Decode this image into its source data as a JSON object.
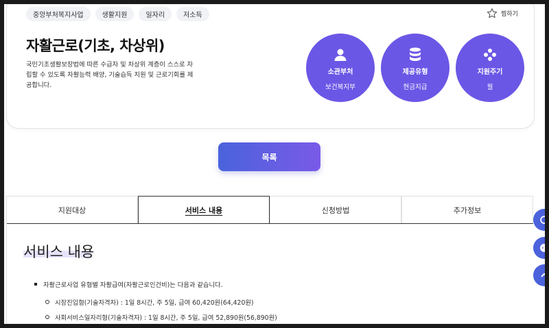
{
  "tags": [
    "중앙부처복지사업",
    "생활지원",
    "일자리",
    "저소득"
  ],
  "favorite_label": "찜하기",
  "title": "자활근로(기초, 차상위)",
  "description": "국민기초생활보장법에 따른 수급자 및 차상위 계층이 스스로 자립할 수 있도록 자활능력 배양, 기술습득 지원 및 근로기회를 제공합니다.",
  "info": [
    {
      "label": "소관부처",
      "value": "보건복지부",
      "icon": "person-icon"
    },
    {
      "label": "제공유형",
      "value": "현금지급",
      "icon": "database-icon"
    },
    {
      "label": "지원주기",
      "value": "월",
      "icon": "dots-diamond-icon"
    }
  ],
  "list_button": "목록",
  "tabs": [
    "지원대상",
    "서비스 내용",
    "신청방법",
    "추가정보"
  ],
  "active_tab": 1,
  "content": {
    "title": "서비스 내용",
    "bullet": "자활근로사업 유형별 자활급여(자활근로인건비)는 다음과 같습니다.",
    "sub_items": [
      "시장진입형(기술자격자) : 1일 8시간, 주 5일, 급여 60,420원(64,420원)",
      "사회서비스일자리형(기술자격자) : 1일 8시간, 주 5일, 급여 52,890원(56,890원)"
    ]
  },
  "colors": {
    "accent": "#6b57e6",
    "button_start": "#4a63dc",
    "button_end": "#7a5ae8",
    "float": "#4b62dc"
  }
}
